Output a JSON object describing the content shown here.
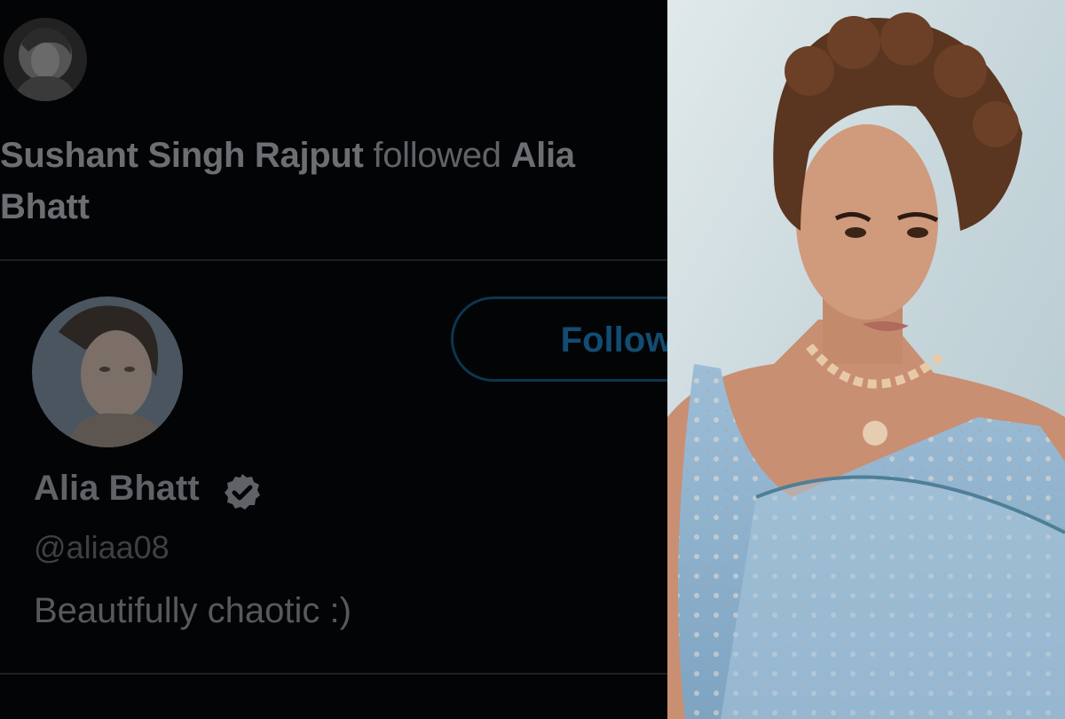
{
  "activity": {
    "actor": "Sushant Singh Rajput",
    "verb": "followed",
    "target_line1": "Alia",
    "target_line2": "Bhatt"
  },
  "card": {
    "name": "Alia Bhatt",
    "handle": "@aliaa08",
    "bio": "Beautifully chaotic :)",
    "follow_label": "Follow",
    "verified_icon": "verified-badge-icon"
  },
  "colors": {
    "background": "#030405",
    "follow_accent": "#124c72",
    "photo_dress": "#8fb4d0"
  }
}
